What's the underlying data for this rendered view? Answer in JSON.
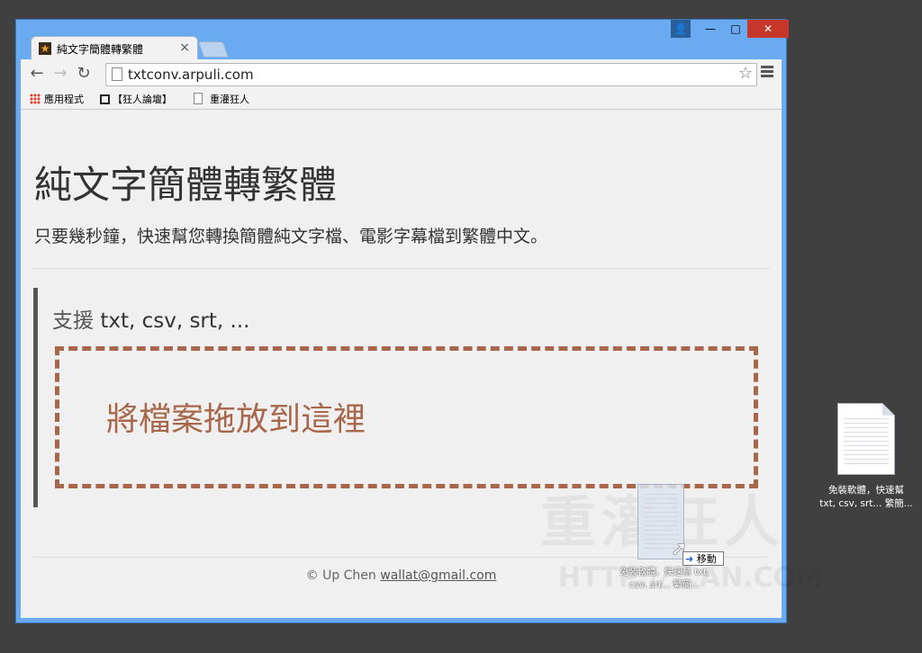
{
  "browser": {
    "tab": {
      "title": "純文字簡體轉繁體",
      "close": "×",
      "favicon": "★"
    },
    "controls": {
      "profile": "👤",
      "minimize": "—",
      "maximize": "□",
      "close": "✕"
    },
    "nav": {
      "back": "←",
      "forward": "→",
      "reload": "↻"
    },
    "address": {
      "url": "txtconv.arpuli.com",
      "star": "☆"
    },
    "bookmarks": [
      {
        "label": "應用程式",
        "icon": "apps-icon"
      },
      {
        "label": "【狂人論壇】",
        "icon": "forum-icon"
      },
      {
        "label": "重灌狂人",
        "icon": "page-icon"
      }
    ]
  },
  "page": {
    "title": "純文字簡體轉繁體",
    "lead": "只要幾秒鐘，快速幫您轉換簡體純文字檔、電影字幕檔到繁體中文。",
    "support_prefix": "支援 ",
    "support_formats": "txt, csv, srt, ...",
    "dropzone_text": "將檔案拖放到這裡",
    "footer_prefix": "© Up Chen ",
    "footer_email": "wallat@gmail.com",
    "watermark": "重灌狂人",
    "watermark_url": "HTTP://...AN.COM"
  },
  "drag": {
    "tooltip_arrow": "➜",
    "tooltip_text": "移動",
    "label": "免裝軟體，快速幫 txt, csv, srt... 繁簡..."
  },
  "desktop": {
    "file_label": "免裝軟體，快速幫\ntxt, csv, srt... 繁簡..."
  }
}
